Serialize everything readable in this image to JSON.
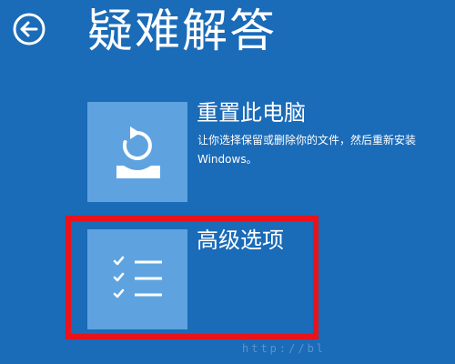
{
  "page": {
    "title": "疑难解答",
    "background_color": "#1a6bb8",
    "tile_color": "#5ea3df",
    "highlight_color": "#e8131b"
  },
  "back_button": {
    "icon": "back-arrow-circle-icon"
  },
  "options": [
    {
      "title": "重置此电脑",
      "description": "让你选择保留或删除你的文件，然后重新安装 Windows。",
      "icon": "reset-pc-icon"
    },
    {
      "title": "高级选项",
      "icon": "checklist-icon"
    }
  ],
  "watermark": {
    "text": "http://bl"
  }
}
